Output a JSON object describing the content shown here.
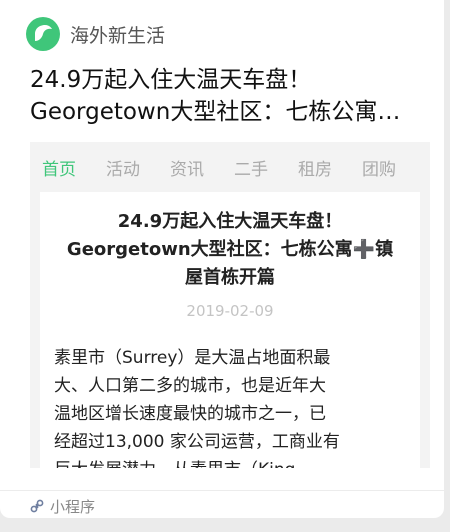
{
  "header": {
    "brand": "海外新生活",
    "logo_icon": "leaf-icon",
    "accent": "#3fc67a"
  },
  "card_title": {
    "line1": "24.9万起入住大温天车盘！",
    "line2": "Georgetown大型社区：七栋公寓…"
  },
  "tabs": [
    {
      "label": "首页",
      "active": true
    },
    {
      "label": "活动"
    },
    {
      "label": "资讯"
    },
    {
      "label": "二手"
    },
    {
      "label": "租房"
    },
    {
      "label": "团购"
    }
  ],
  "article": {
    "title_lines": [
      "24.9万起入住大温天车盘！",
      "Georgetown大型社区：七栋公寓➕镇",
      "屋首栋开篇"
    ],
    "date": "2019-02-09",
    "body_lines": [
      "素里市（Surrey）是大温占地面积最",
      "大、人口第二多的城市，也是近年大",
      "温地区增长速度最快的城市之一，已",
      "经超过13,000 家公司运营，工商业有",
      "巨大发展潜力，从素里市（King"
    ]
  },
  "footer": {
    "label": "小程序",
    "icon": "mini-program-icon"
  }
}
